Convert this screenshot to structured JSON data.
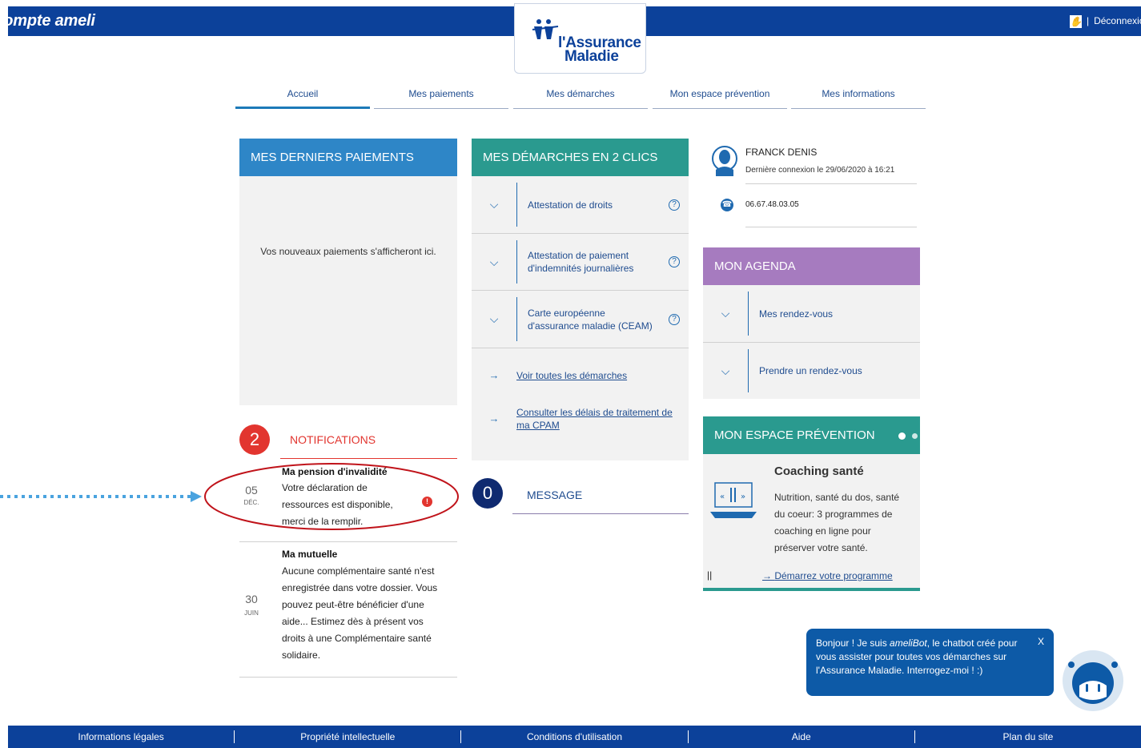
{
  "header": {
    "brand": "Compte ameli",
    "logout": "Déconnexion",
    "logo_line1": "l'Assurance",
    "logo_line2": "Maladie",
    "colors": {
      "bar": "#0c419a"
    }
  },
  "nav": {
    "tabs": [
      {
        "label": "Accueil"
      },
      {
        "label": "Mes paiements"
      },
      {
        "label": "Mes démarches"
      },
      {
        "label": "Mon espace prévention"
      },
      {
        "label": "Mes informations"
      }
    ]
  },
  "payments": {
    "title": "MES DERNIERS PAIEMENTS",
    "empty": "Vos nouveaux paiements s'afficheront ici.",
    "color": "#2e86c7"
  },
  "notifications": {
    "count": "2",
    "title": "NOTIFICATIONS",
    "items": [
      {
        "day": "05",
        "month": "DÉC.",
        "title": "Ma pension d'invalidité",
        "body": "Votre déclaration de ressources est disponible, merci de la remplir."
      },
      {
        "day": "30",
        "month": "JUIN",
        "title": "Ma mutuelle",
        "body": "Aucune complémentaire santé n'est enregistrée dans votre dossier. Vous pouvez peut-être bénéficier d'une aide... Estimez dès à présent vos droits à une Complémentaire santé solidaire."
      }
    ]
  },
  "demarches": {
    "title": "MES DÉMARCHES EN 2 CLICS",
    "color": "#2a9a8f",
    "items": [
      {
        "label": "Attestation de droits"
      },
      {
        "label": "Attestation de paiement d'indemnités journalières"
      },
      {
        "label": "Carte européenne d'assurance maladie (CEAM)"
      }
    ],
    "links": [
      {
        "label": "Voir toutes les démarches"
      },
      {
        "label": "Consulter les délais de traitement de ma CPAM"
      }
    ]
  },
  "messages": {
    "count": "0",
    "title": "MESSAGE"
  },
  "profile": {
    "name": "FRANCK DENIS",
    "last_login": "Dernière connexion le 29/06/2020 à 16:21",
    "phone": "06.67.48.03.05"
  },
  "agenda": {
    "title": "MON AGENDA",
    "color": "#a67bbf",
    "items": [
      {
        "label": "Mes rendez-vous"
      },
      {
        "label": "Prendre un rendez-vous"
      }
    ]
  },
  "prevention": {
    "title": "MON ESPACE PRÉVENTION",
    "color": "#2a9a8f",
    "card_title": "Coaching santé",
    "card_body": "Nutrition, santé du dos, santé du coeur: 3 programmes de coaching en ligne pour préserver votre santé.",
    "link": "Démarrez votre programme",
    "pause": "||"
  },
  "chatbot": {
    "message_pre": "Bonjour ! Je suis ",
    "bot_name": "ameliBot",
    "message_post": ", le chatbot créé pour vous assister pour toutes vos démarches sur l'Assurance Maladie. Interrogez-moi ! :)",
    "close": "X"
  },
  "footer": {
    "links": [
      {
        "label": "Informations légales"
      },
      {
        "label": "Propriété intellectuelle"
      },
      {
        "label": "Conditions d'utilisation"
      },
      {
        "label": "Aide"
      },
      {
        "label": "Plan du site"
      }
    ]
  }
}
